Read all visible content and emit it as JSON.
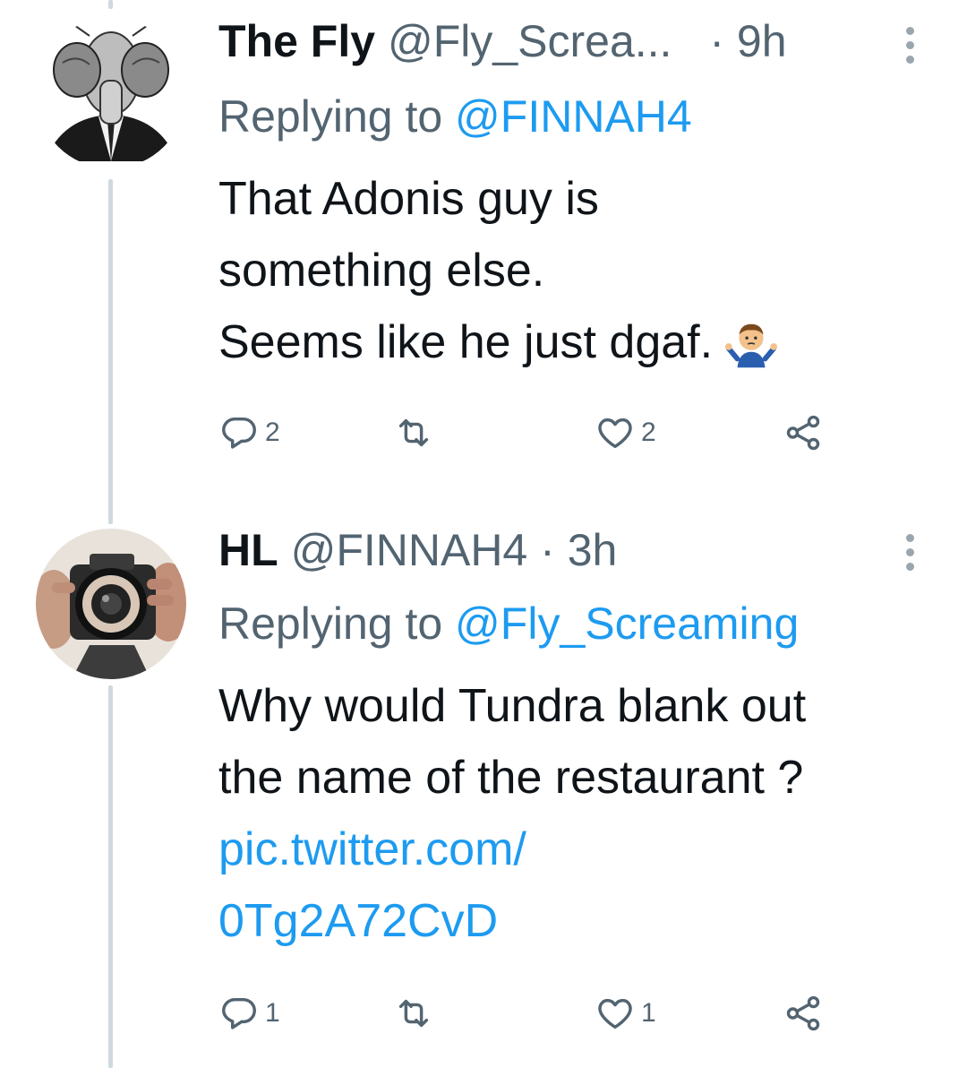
{
  "tweets": [
    {
      "name": "The Fly",
      "handle": "@Fly_Screa...",
      "dot": "·",
      "time": "9h",
      "replying_prefix": "Replying to ",
      "replying_mention": "@FINNAH4",
      "body_lines": [
        "That Adonis guy is",
        "something else.",
        "Seems like he just dgaf."
      ],
      "emoji": "person-shrugging-emoji",
      "avatar": "fly-in-suit-avatar",
      "reply_count": "2",
      "like_count": "2"
    },
    {
      "name": "HL",
      "handle": "@FINNAH4",
      "dot": "·",
      "time": "3h",
      "replying_prefix": "Replying to ",
      "replying_mention": "@Fly_Screaming",
      "body_lines": [
        "Why would Tundra blank out",
        "the name of the restaurant ?"
      ],
      "link_lines": [
        "pic.twitter.com/",
        "0Tg2A72CvD"
      ],
      "avatar": "camera-photographer-avatar",
      "reply_count": "1",
      "like_count": "1"
    }
  ],
  "icons": {
    "reply": "reply-icon",
    "retweet": "retweet-icon",
    "like": "heart-icon",
    "share": "share-icon",
    "more": "more-options-icon"
  },
  "colors": {
    "link": "#1d9bf0",
    "secondary": "#536471",
    "text": "#0f1419",
    "thread_line": "#cfd9de"
  }
}
